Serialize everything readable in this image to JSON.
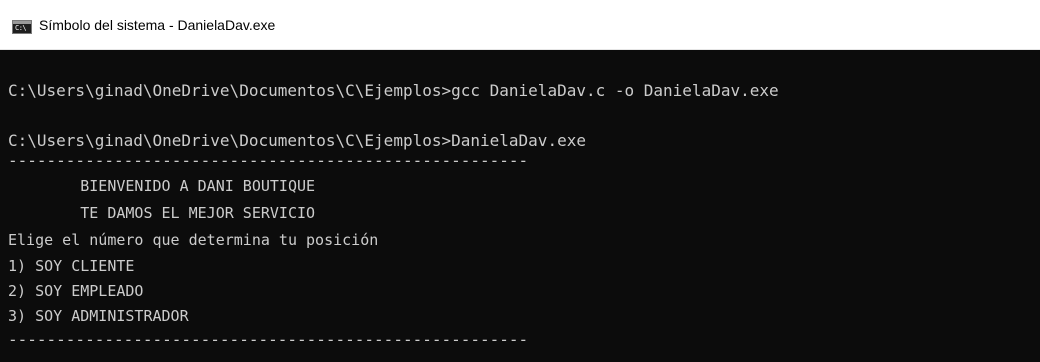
{
  "window": {
    "title": "Símbolo del sistema - DanielaDav.exe",
    "icon_name": "cmd-icon",
    "icon_glyph": "C:\\"
  },
  "console": {
    "lines": [
      "C:\\Users\\ginad\\OneDrive\\Documentos\\C\\Ejemplos>gcc DanielaDav.c -o DanielaDav.exe",
      "C:\\Users\\ginad\\OneDrive\\Documentos\\C\\Ejemplos>DanielaDav.exe",
      "------------------------------------------------------",
      "        BIENVENIDO A DANI BOUTIQUE",
      "        TE DAMOS EL MEJOR SERVICIO",
      "Elige el número que determina tu posición",
      "1) SOY CLIENTE",
      "2) SOY EMPLEADO",
      "3) SOY ADMINISTRADOR",
      "------------------------------------------------------"
    ]
  },
  "colors": {
    "console_background": "#0c0c0c",
    "console_text": "#cccccc",
    "titlebar_background": "#ffffff"
  }
}
